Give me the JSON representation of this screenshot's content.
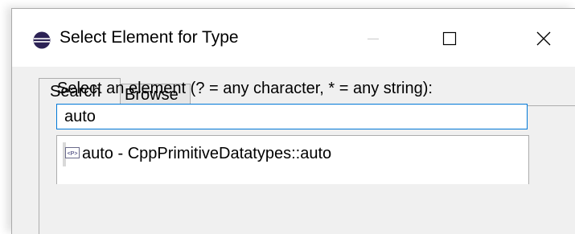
{
  "window": {
    "title": "Select Element for Type",
    "icon": "eclipse-icon"
  },
  "controls": {
    "minimize": "minimize-icon",
    "maximize": "maximize-icon",
    "close": "close-icon"
  },
  "tabs": [
    {
      "label": "Search",
      "active": true
    },
    {
      "label": "Browse",
      "active": false
    }
  ],
  "search": {
    "prompt": "Select an element (? = any character, * = any string):",
    "value": "auto"
  },
  "results": [
    {
      "icon": "primitive-type-icon",
      "icon_text": "<P>",
      "label": "auto - CppPrimitiveDatatypes::auto",
      "selected": true
    }
  ],
  "colors": {
    "focus_border": "#0078d7",
    "panel_background": "#f0f0f0",
    "selection_background": "#d9d9d9"
  }
}
